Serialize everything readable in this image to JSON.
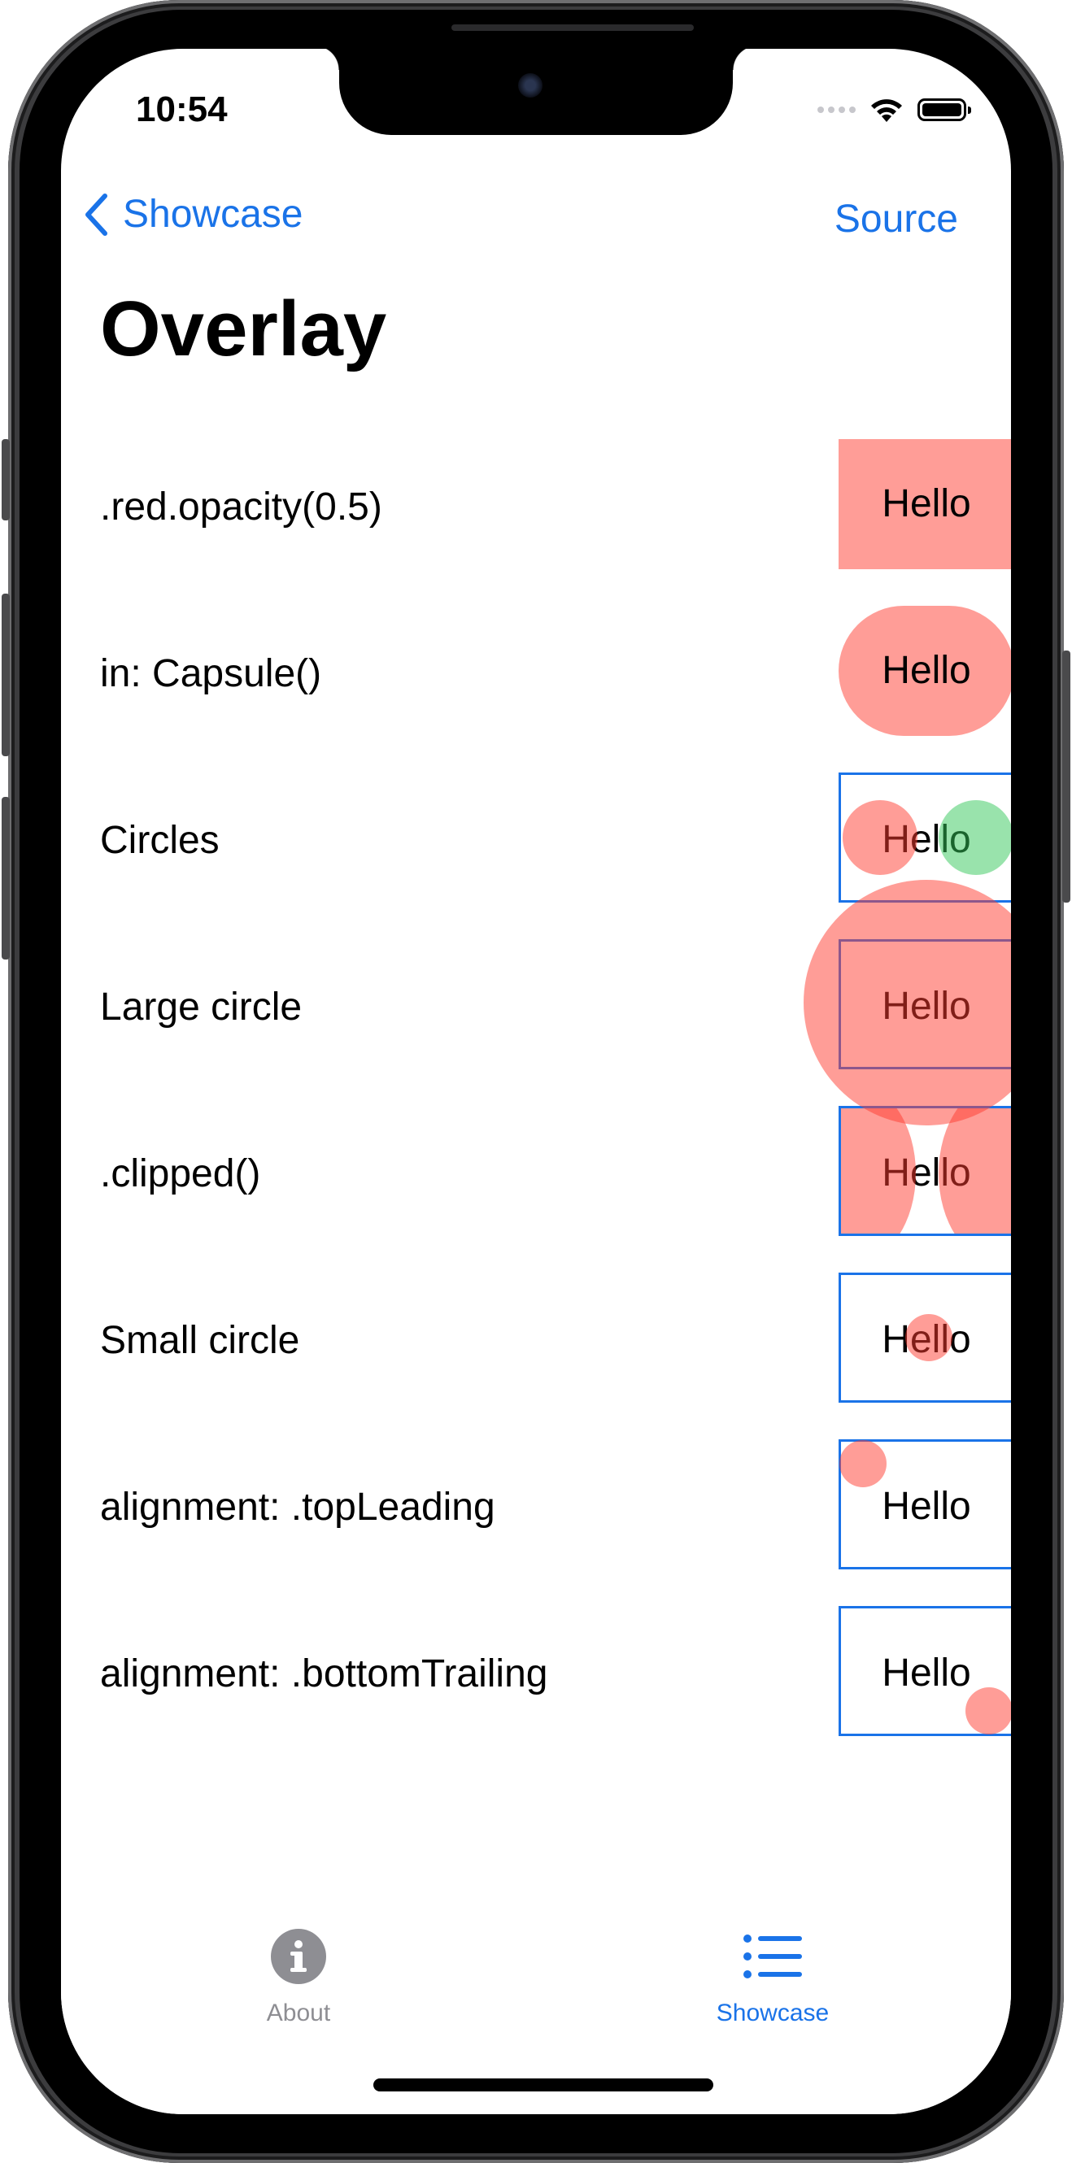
{
  "status_bar": {
    "time": "10:54"
  },
  "nav": {
    "back_label": "Showcase",
    "source_label": "Source"
  },
  "title": "Overlay",
  "sample_text": "Hello",
  "rows": [
    {
      "label": ".red.opacity(0.5)"
    },
    {
      "label": "in: Capsule()"
    },
    {
      "label": "Circles"
    },
    {
      "label": "Large circle"
    },
    {
      "label": ".clipped()"
    },
    {
      "label": "Small circle"
    },
    {
      "label": "alignment: .topLeading"
    },
    {
      "label": "alignment: .bottomTrailing"
    }
  ],
  "tabbar": {
    "items": [
      {
        "label": "About",
        "icon": "info-icon",
        "selected": false
      },
      {
        "label": "Showcase",
        "icon": "list-icon",
        "selected": true
      }
    ]
  },
  "colors": {
    "accent": "#1a73e8",
    "overlay_red": "#ff3b30",
    "overlay_green": "#34c759",
    "inactive_tab": "#8e8e93"
  }
}
